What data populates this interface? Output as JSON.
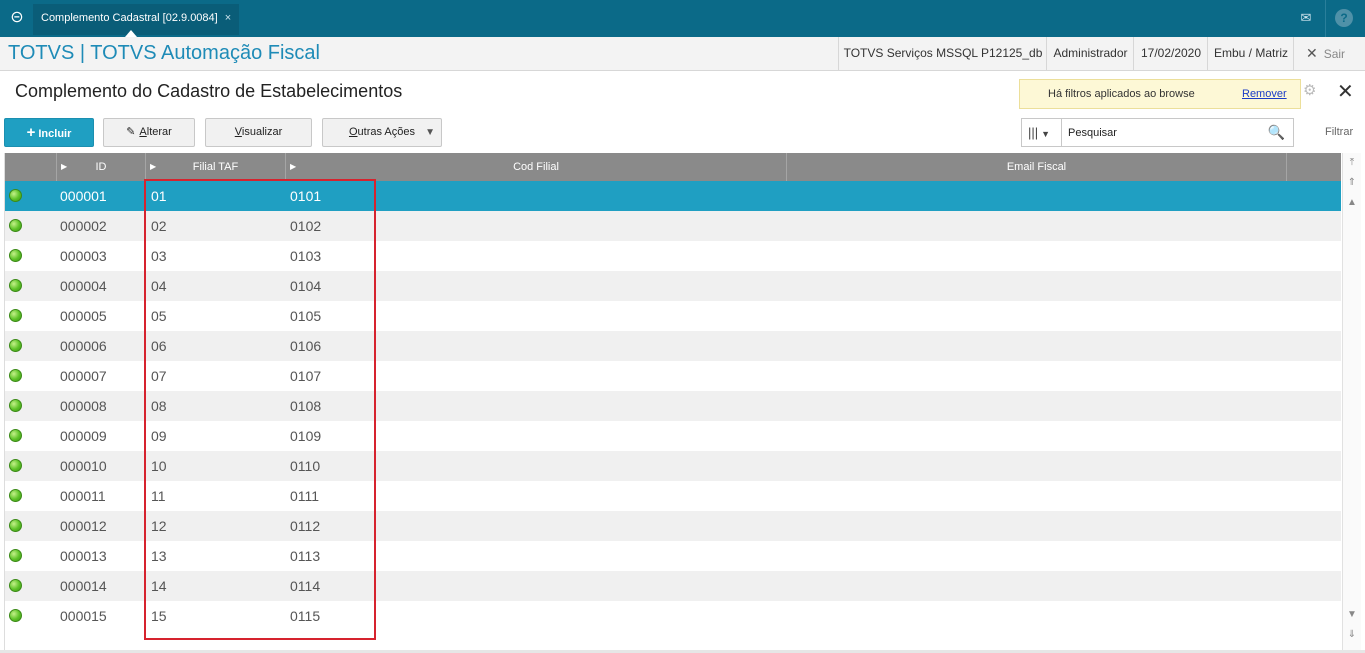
{
  "window": {
    "tab_label": "Complemento Cadastral [02.9.0084]",
    "tab_close": "×"
  },
  "header": {
    "app_title": "TOTVS | TOTVS Automação Fiscal",
    "environment": "TOTVS Serviços MSSQL P12125_db",
    "user": "Administrador",
    "date": "17/02/2020",
    "branch": "Embu / Matriz",
    "exit_label": "Sair"
  },
  "page": {
    "title": "Complemento do Cadastro de Estabelecimentos",
    "filter_notice": "Há filtros aplicados ao browse",
    "filter_remove": "Remover"
  },
  "toolbar": {
    "incluir": "Incluir",
    "alterar_first": "A",
    "alterar_rest": "lterar",
    "visualizar_first": "V",
    "visualizar_rest": "isualizar",
    "outras_first": "O",
    "outras_rest": "utras Ações",
    "search_placeholder": "Pesquisar",
    "filtrar": "Filtrar"
  },
  "grid": {
    "columns": [
      "ID",
      "Filial TAF",
      "Cod Filial",
      "Email Fiscal"
    ],
    "rows": [
      {
        "id": "000001",
        "filial": "01",
        "cod": "0101"
      },
      {
        "id": "000002",
        "filial": "02",
        "cod": "0102"
      },
      {
        "id": "000003",
        "filial": "03",
        "cod": "0103"
      },
      {
        "id": "000004",
        "filial": "04",
        "cod": "0104"
      },
      {
        "id": "000005",
        "filial": "05",
        "cod": "0105"
      },
      {
        "id": "000006",
        "filial": "06",
        "cod": "0106"
      },
      {
        "id": "000007",
        "filial": "07",
        "cod": "0107"
      },
      {
        "id": "000008",
        "filial": "08",
        "cod": "0108"
      },
      {
        "id": "000009",
        "filial": "09",
        "cod": "0109"
      },
      {
        "id": "000010",
        "filial": "10",
        "cod": "0110"
      },
      {
        "id": "000011",
        "filial": "11",
        "cod": "0111"
      },
      {
        "id": "000012",
        "filial": "12",
        "cod": "0112"
      },
      {
        "id": "000013",
        "filial": "13",
        "cod": "0113"
      },
      {
        "id": "000014",
        "filial": "14",
        "cod": "0114"
      },
      {
        "id": "000015",
        "filial": "15",
        "cod": "0115"
      }
    ],
    "selected_row": 0
  },
  "colors": {
    "topbar": "#0b6a88",
    "accent": "#1f9fc2",
    "status_green": "#5cc226",
    "highlight_red": "#d6232e"
  }
}
